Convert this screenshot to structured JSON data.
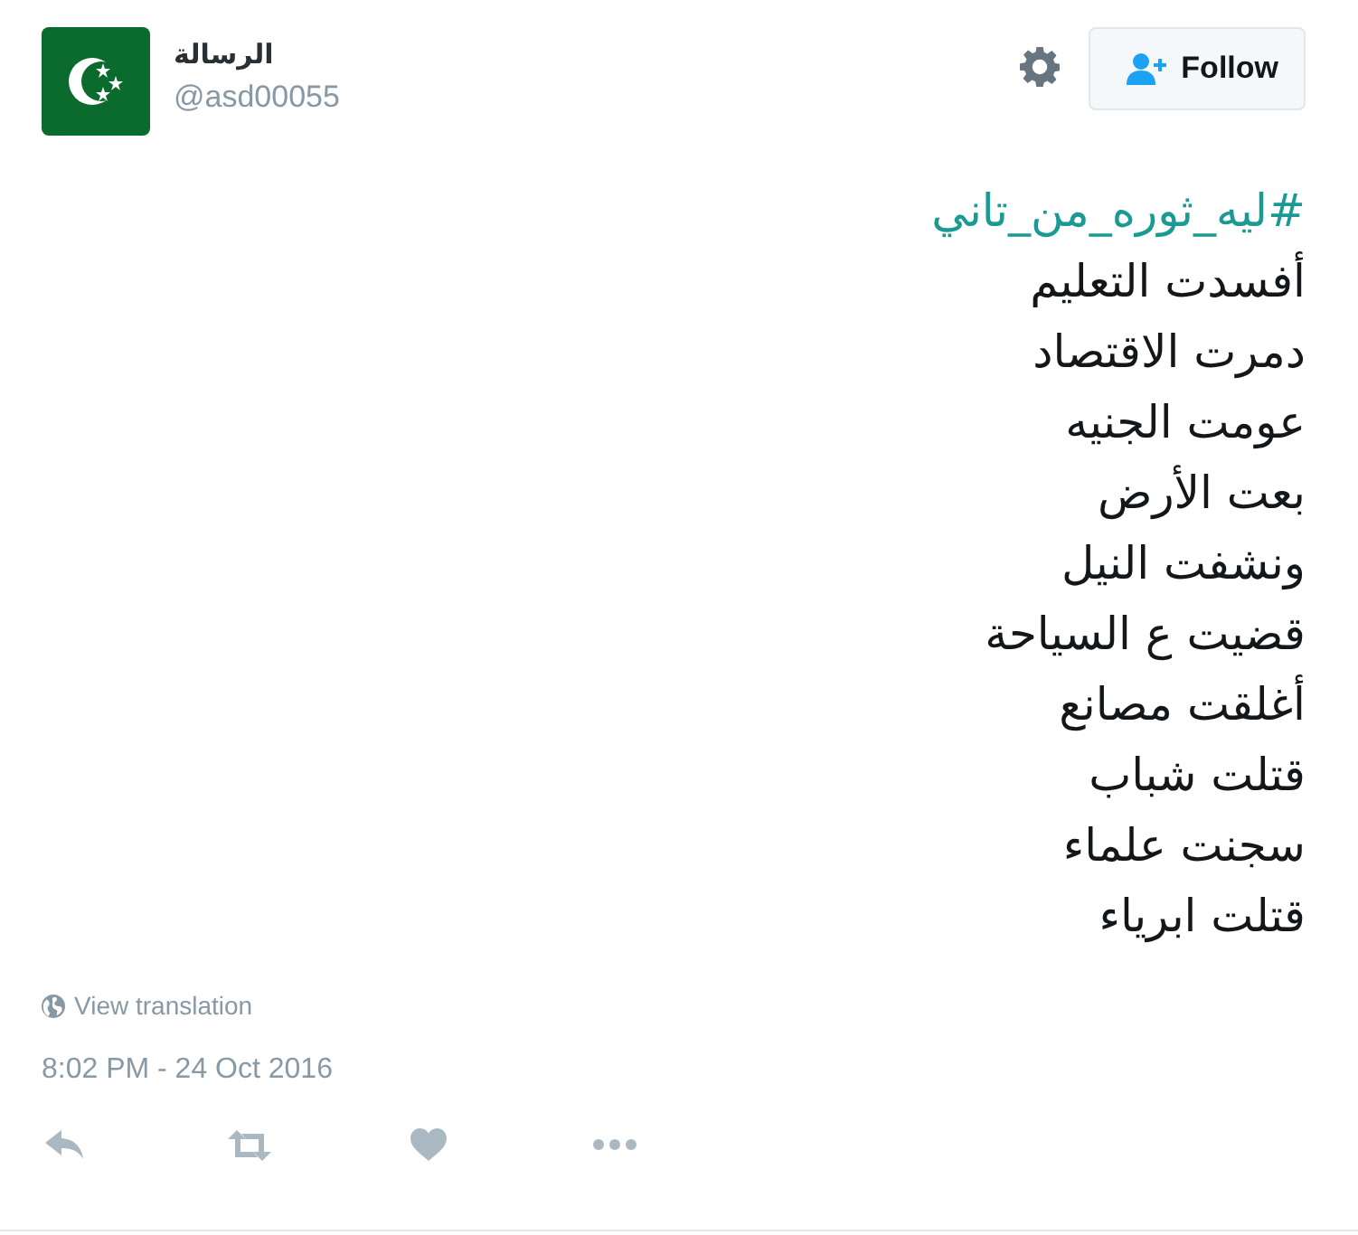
{
  "author": {
    "name": "الرسالة",
    "handle": "@asd00055"
  },
  "follow_button": {
    "label": "Follow"
  },
  "tweet": {
    "hashtag": "#ليه_ثوره_من_تاني",
    "lines": [
      "أفسدت التعليم",
      "دمرت الاقتصاد",
      "عومت الجنيه",
      "بعت الأرض",
      "ونشفت النيل",
      "قضيت ع السياحة",
      "أغلقت مصانع",
      "قتلت شباب",
      "سجنت علماء",
      "قتلت ابرياء"
    ]
  },
  "translation_link": "View translation",
  "timestamp": "8:02 PM - 24 Oct 2016",
  "actions": [
    {
      "kind": "reply"
    },
    {
      "kind": "retweet"
    },
    {
      "kind": "like"
    },
    {
      "kind": "more"
    }
  ]
}
